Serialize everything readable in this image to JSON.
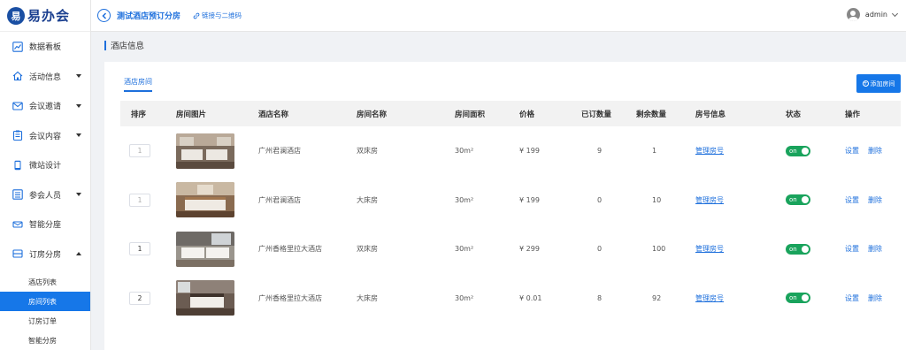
{
  "logo": {
    "mark": "易",
    "text": "易办会"
  },
  "sidebar": {
    "items": [
      {
        "label": "数据看板",
        "icon": "chart-icon",
        "caret": ""
      },
      {
        "label": "活动信息",
        "icon": "home-icon",
        "caret": "down"
      },
      {
        "label": "会议邀请",
        "icon": "mail-icon",
        "caret": "down"
      },
      {
        "label": "会议内容",
        "icon": "clipboard-icon",
        "caret": "down"
      },
      {
        "label": "微站设计",
        "icon": "phone-icon",
        "caret": ""
      },
      {
        "label": "参会人员",
        "icon": "list-icon",
        "caret": "down"
      },
      {
        "label": "智能分座",
        "icon": "seat-icon",
        "caret": ""
      },
      {
        "label": "订房分房",
        "icon": "bed-icon",
        "caret": "up"
      }
    ],
    "subitems": [
      {
        "label": "酒店列表",
        "active": false
      },
      {
        "label": "房间列表",
        "active": true
      },
      {
        "label": "订房订单",
        "active": false
      },
      {
        "label": "智能分房",
        "active": false
      }
    ]
  },
  "header": {
    "project_title": "测试酒店预订分房",
    "link_qr": "链接与二维码",
    "username": "admin"
  },
  "page": {
    "title": "酒店信息",
    "tab": "酒店房间",
    "add_button": "添加房间"
  },
  "table": {
    "columns": [
      "排序",
      "房间图片",
      "酒店名称",
      "房间名称",
      "房间面积",
      "价格",
      "已订数量",
      "剩余数量",
      "房号信息",
      "状态",
      "操作"
    ],
    "rows": [
      {
        "order": "1",
        "order_dim": true,
        "hotel": "广州君澜酒店",
        "room": "双床房",
        "area": "30m²",
        "price": "¥ 199",
        "booked": "9",
        "remaining": "1",
        "manage": "管理房号",
        "status": "on",
        "edit": "设置",
        "delete": "删除"
      },
      {
        "order": "1",
        "order_dim": true,
        "hotel": "广州君澜酒店",
        "room": "大床房",
        "area": "30m²",
        "price": "¥ 199",
        "booked": "0",
        "remaining": "10",
        "manage": "管理房号",
        "status": "on",
        "edit": "设置",
        "delete": "删除"
      },
      {
        "order": "1",
        "order_dim": false,
        "hotel": "广州香格里拉大酒店",
        "room": "双床房",
        "area": "30m²",
        "price": "¥ 299",
        "booked": "0",
        "remaining": "100",
        "manage": "管理房号",
        "status": "on",
        "edit": "设置",
        "delete": "删除"
      },
      {
        "order": "2",
        "order_dim": false,
        "hotel": "广州香格里拉大酒店",
        "room": "大床房",
        "area": "30m²",
        "price": "¥ 0.01",
        "booked": "8",
        "remaining": "92",
        "manage": "管理房号",
        "status": "on",
        "edit": "设置",
        "delete": "删除"
      }
    ]
  },
  "colors": {
    "accent": "#1677e8",
    "toggle_on": "#19a35c"
  }
}
